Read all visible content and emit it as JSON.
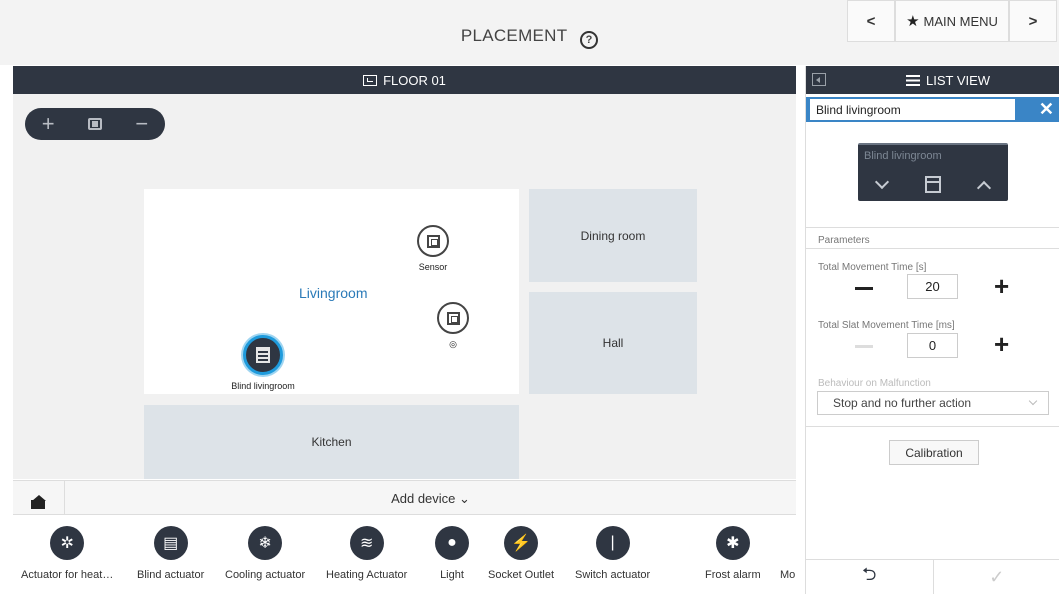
{
  "header": {
    "title": "PLACEMENT",
    "help_icon": "?",
    "nav": {
      "prev": "<",
      "main_menu": "MAIN MENU",
      "next": ">"
    }
  },
  "floor": {
    "title": "FLOOR 01",
    "zoom": {
      "in": "+",
      "out": "−"
    },
    "rooms": {
      "living": "Livingroom",
      "dining": "Dining room",
      "hall": "Hall",
      "kitchen": "Kitchen"
    },
    "devices": {
      "sensor": "Sensor",
      "sensor2": "◎",
      "blind": "Blind livingroom"
    }
  },
  "add_device": {
    "label": "Add device ⌄"
  },
  "device_strip": [
    {
      "label": "Actuator for heat…",
      "icon": "actuator-heating-icon",
      "glyph": "✲"
    },
    {
      "label": "Blind actuator",
      "icon": "blind-icon",
      "glyph": "▤"
    },
    {
      "label": "Cooling actuator",
      "icon": "snowflake-icon",
      "glyph": "❄"
    },
    {
      "label": "Heating Actuator",
      "icon": "heat-waves-icon",
      "glyph": "≋"
    },
    {
      "label": "Light",
      "icon": "bulb-icon",
      "glyph": "●"
    },
    {
      "label": "Socket Outlet",
      "icon": "socket-icon",
      "glyph": "⚡"
    },
    {
      "label": "Switch actuator",
      "icon": "switch-icon",
      "glyph": "|"
    },
    {
      "label": "Frost alarm",
      "icon": "frost-icon",
      "glyph": "✱"
    },
    {
      "label": "Mo",
      "icon": "",
      "glyph": ""
    }
  ],
  "panel": {
    "header": "LIST VIEW",
    "device_name": "Blind livingroom",
    "close": "✕",
    "tile_name": "Blind livingroom",
    "parameters_heading": "Parameters",
    "movement_time": {
      "label": "Total Movement Time [s]",
      "value": "20",
      "plus": "+"
    },
    "slat_time": {
      "label": "Total Slat Movement Time [ms]",
      "value": "0",
      "plus": "+"
    },
    "malfunction": {
      "label": "Behaviour on Malfunction",
      "value": "Stop and no further action"
    },
    "calibration": "Calibration",
    "footer": {
      "back": "⮌",
      "confirm": "✓"
    }
  },
  "colors": {
    "dark": "#2f3642",
    "accent": "#3a85c6",
    "room": "#dde3e8"
  }
}
